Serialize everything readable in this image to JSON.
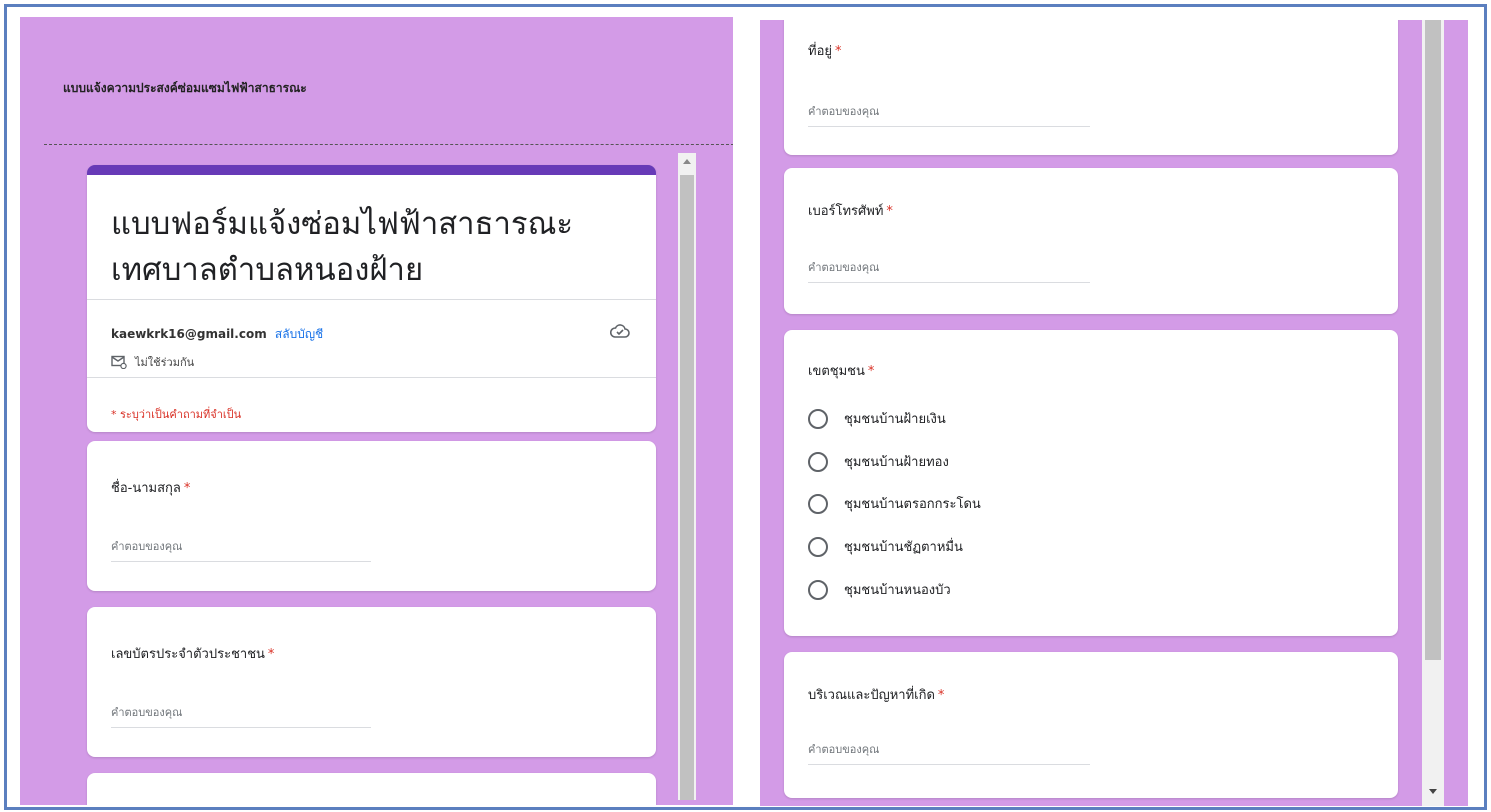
{
  "left": {
    "heading": "แบบแจ้งความประสงค์ซ่อมแซมไฟฟ้าสาธารณะ",
    "form_title_line1": "แบบฟอร์มแจ้งซ่อมไฟฟ้าสาธารณะ",
    "form_title_line2": "เทศบาลตำบลหนองฝ้าย",
    "account_email": "kaewkrk16@gmail.com",
    "switch_account": "สลับบัญชี",
    "not_shared": "ไม่ใช้ร่วมกัน",
    "required_note": "* ระบุว่าเป็นคำถามที่จำเป็น",
    "questions": [
      {
        "label": "ชื่อ-นามสกุล",
        "placeholder": "คำตอบของคุณ"
      },
      {
        "label": "เลขบัตรประจำตัวประชาชน",
        "placeholder": "คำตอบของคุณ"
      }
    ]
  },
  "right": {
    "address": {
      "label": "ที่อยู่",
      "placeholder": "คำตอบของคุณ"
    },
    "phone": {
      "label": "เบอร์โทรศัพท์",
      "placeholder": "คำตอบของคุณ"
    },
    "community": {
      "label": "เขตชุมชน",
      "options": [
        "ชุมชนบ้านฝ้ายเงิน",
        "ชุมชนบ้านฝ้ายทอง",
        "ชุมชนบ้านตรอกกระโดน",
        "ชุมชนบ้านชัฏตาหมื่น",
        "ชุมชนบ้านหนองบัว"
      ]
    },
    "problem": {
      "label": "บริเวณและปัญหาที่เกิด",
      "placeholder": "คำตอบของคุณ"
    }
  },
  "asterisk": "*",
  "colors": {
    "background": "#d39be7",
    "accent": "#673ab7",
    "required": "#d93025",
    "link": "#1a73e8"
  }
}
